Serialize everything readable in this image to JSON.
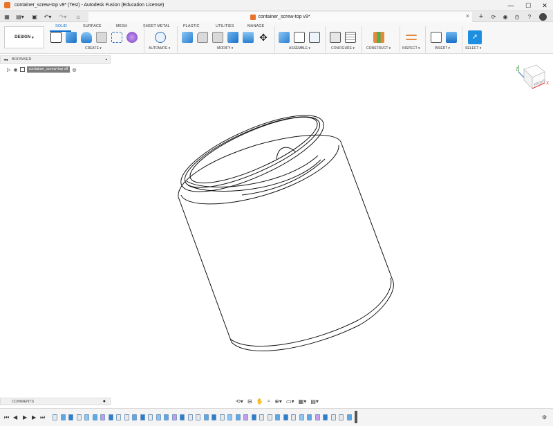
{
  "window": {
    "title": "container_screw-top v9* (Test) - Autodesk Fusion (Education License)"
  },
  "document_tab": {
    "name": "container_screw-top v9*"
  },
  "workspace": {
    "label": "DESIGN",
    "caret": "▾"
  },
  "tabs": [
    {
      "label": "SOLID",
      "active": true
    },
    {
      "label": "SURFACE",
      "active": false
    },
    {
      "label": "MESH",
      "active": false
    },
    {
      "label": "SHEET METAL",
      "active": false
    },
    {
      "label": "PLASTIC",
      "active": false
    },
    {
      "label": "UTILITIES",
      "active": false
    },
    {
      "label": "MANAGE",
      "active": false
    }
  ],
  "groups": [
    "CREATE ▾",
    "AUTOMATE ▾",
    "MODIFY ▾",
    "ASSEMBLE ▾",
    "CONFIGURE ▾",
    "CONSTRUCT ▾",
    "INSPECT ▾",
    "INSERT ▾",
    "SELECT ▾"
  ],
  "browser": {
    "label": "BROWSER",
    "component": "container_screw-top v9"
  },
  "comments": {
    "label": "COMMENTS"
  },
  "viewcube": {
    "face": "FRONT"
  },
  "colors": {
    "accent": "#0a6ed1",
    "brand": "#e8742c"
  }
}
